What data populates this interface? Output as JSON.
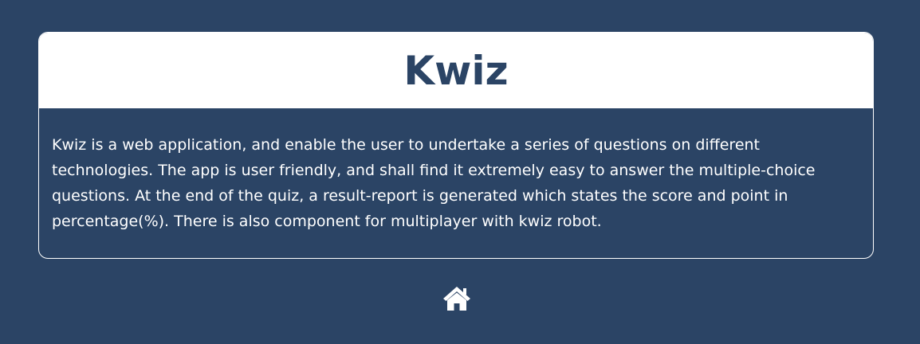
{
  "app": {
    "title": "Kwiz",
    "description": "Kwiz is a web application, and enable the user to undertake a series of questions on different technologies. The app is user friendly, and shall find it extremely easy to answer the multiple-choice questions. At the end of the quiz, a result-report is generated which states the score and point in percentage(%). There is also component for multiplayer with kwiz robot."
  },
  "nav": {
    "home_icon": "home-icon"
  },
  "colors": {
    "background": "#2b4465",
    "header_background": "#ffffff",
    "title_text": "#2b4465",
    "body_text": "#ffffff"
  }
}
